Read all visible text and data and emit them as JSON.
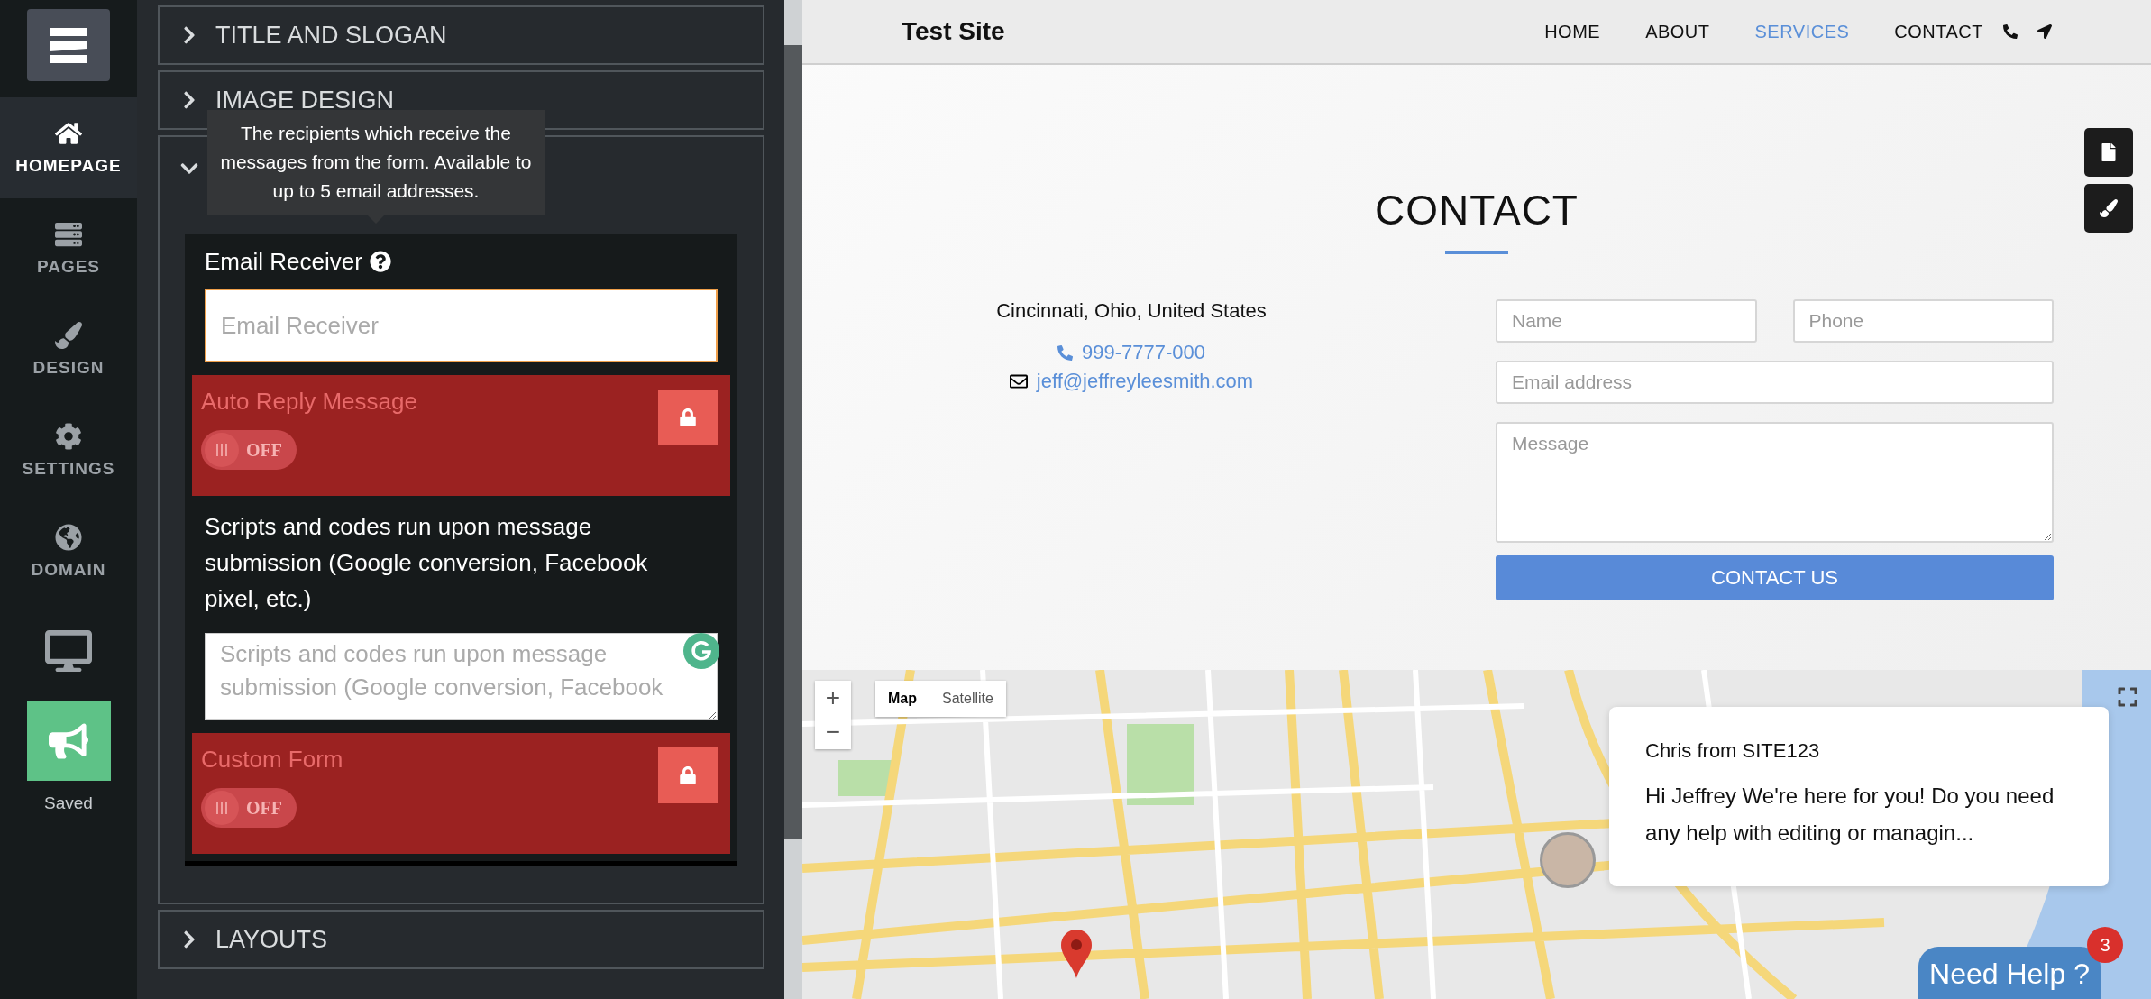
{
  "sidebar": {
    "items": [
      {
        "label": "HOMEPAGE",
        "selected": true,
        "kind": "home"
      },
      {
        "label": "PAGES",
        "selected": false,
        "kind": "pages"
      },
      {
        "label": "DESIGN",
        "selected": false,
        "kind": "design"
      },
      {
        "label": "SETTINGS",
        "selected": false,
        "kind": "settings"
      },
      {
        "label": "DOMAIN",
        "selected": false,
        "kind": "domain"
      }
    ],
    "publish_status": "Saved"
  },
  "panel": {
    "sections": [
      {
        "title": "TITLE AND SLOGAN",
        "expanded": false
      },
      {
        "title": "IMAGE DESIGN",
        "expanded": false
      },
      {
        "expanded": true,
        "tooltip": "The recipients which receive the messages from the form. Available to up to 5 email addresses.",
        "settings": [
          {
            "kind": "text_field",
            "label": "Email Receiver",
            "placeholder": "Email Receiver"
          },
          {
            "kind": "locked_toggle",
            "label": "Auto Reply Message",
            "on": false,
            "toggle_text": "OFF"
          },
          {
            "kind": "textarea",
            "label": "Scripts and codes run upon message submission (Google conversion, Facebook pixel, etc.)",
            "placeholder": "Scripts and codes run upon message submission (Google conversion, Facebook"
          },
          {
            "kind": "locked_toggle",
            "label": "Custom Form",
            "on": false,
            "toggle_text": "OFF"
          }
        ]
      },
      {
        "title": "LAYOUTS",
        "expanded": false
      }
    ]
  },
  "site": {
    "header": {
      "logo": "Test Site",
      "nav": [
        {
          "label": "HOME",
          "selected": false
        },
        {
          "label": "ABOUT",
          "selected": false
        },
        {
          "label": "SERVICES",
          "selected": true
        },
        {
          "label": "CONTACT",
          "selected": false
        }
      ]
    },
    "contact": {
      "title": "CONTACT",
      "address": "Cincinnati, Ohio, United States",
      "phone": "999-7777-000",
      "email": "jeff@jeffreyleesmith.com",
      "form": {
        "fields": [
          {
            "kind": "input",
            "placeholder": "Name"
          },
          {
            "kind": "input",
            "placeholder": "Phone"
          },
          {
            "kind": "input",
            "placeholder": "Email address"
          },
          {
            "kind": "textarea",
            "placeholder": "Message"
          }
        ],
        "submit": "CONTACT US"
      }
    },
    "map": {
      "zoom_in": "+",
      "zoom_out": "−",
      "types": [
        {
          "label": "Map",
          "selected": true
        },
        {
          "label": "Satellite",
          "selected": false
        }
      ]
    },
    "chat": {
      "sender": "Chris from SITE123",
      "message": "Hi Jeffrey We're here for you! Do you need any help with editing or managin...",
      "help_button": "Need Help ?",
      "badge": "3"
    }
  }
}
